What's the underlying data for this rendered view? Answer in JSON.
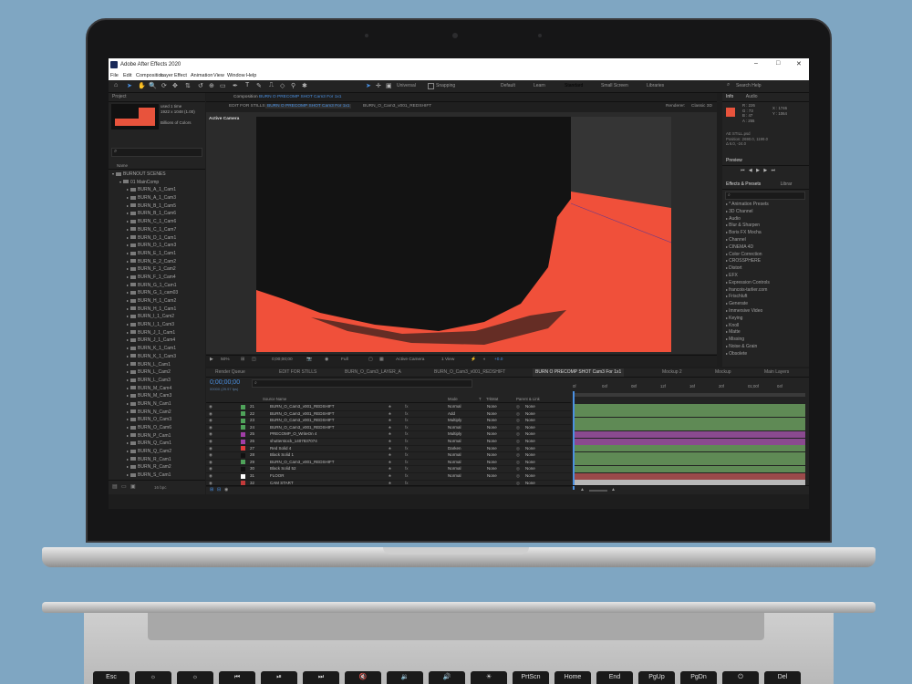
{
  "app": {
    "title": "Adobe After Effects 2020",
    "menu": [
      "File",
      "Edit",
      "Composition",
      "Layer",
      "Effect",
      "Animation",
      "View",
      "Window",
      "Help"
    ],
    "window_controls": [
      "–",
      "□",
      "✕"
    ]
  },
  "toolbar": {
    "universal_label": "Universal",
    "snapping_label": "Snapping",
    "workspaces": [
      "Default",
      "Learn",
      "Standard",
      "Small Screen",
      "Libraries"
    ],
    "search_help": "Search Help"
  },
  "project": {
    "tab": "Project",
    "thumb_info": [
      "1922 x 1048 (1.00)",
      "Billions of Colors"
    ],
    "used_text": "used 1 time",
    "name_header": "Name",
    "items": [
      {
        "label": "BURNOUT SCENES",
        "level": 0,
        "kind": "folder"
      },
      {
        "label": "01 MainComp",
        "level": 1,
        "kind": "folder"
      },
      {
        "label": "BURN_A_1_Cam1",
        "level": 2,
        "kind": "folder"
      },
      {
        "label": "BURN_A_1_Cam3",
        "level": 2,
        "kind": "folder"
      },
      {
        "label": "BURN_B_1_Cam5",
        "level": 2,
        "kind": "folder"
      },
      {
        "label": "BURN_B_1_Cam6",
        "level": 2,
        "kind": "folder"
      },
      {
        "label": "BURN_C_1_Cam6",
        "level": 2,
        "kind": "folder"
      },
      {
        "label": "BURN_C_1_Cam7",
        "level": 2,
        "kind": "folder"
      },
      {
        "label": "BURN_D_1_Cam1",
        "level": 2,
        "kind": "folder"
      },
      {
        "label": "BURN_D_1_Cam3",
        "level": 2,
        "kind": "folder"
      },
      {
        "label": "BURN_E_1_Cam1",
        "level": 2,
        "kind": "folder"
      },
      {
        "label": "BURN_E_2_Cam2",
        "level": 2,
        "kind": "folder"
      },
      {
        "label": "BURN_F_1_Cam2",
        "level": 2,
        "kind": "folder"
      },
      {
        "label": "BURN_F_1_Cam4",
        "level": 2,
        "kind": "folder"
      },
      {
        "label": "BURN_G_1_Cam1",
        "level": 2,
        "kind": "folder"
      },
      {
        "label": "BURN_G_1_cam03",
        "level": 2,
        "kind": "folder"
      },
      {
        "label": "BURN_H_1_Cam2",
        "level": 2,
        "kind": "folder"
      },
      {
        "label": "BURN_H_1_Cam1",
        "level": 2,
        "kind": "folder"
      },
      {
        "label": "BURN_I_1_Cam2",
        "level": 2,
        "kind": "folder"
      },
      {
        "label": "BURN_I_1_Cam3",
        "level": 2,
        "kind": "folder"
      },
      {
        "label": "BURN_J_1_Cam1",
        "level": 2,
        "kind": "folder"
      },
      {
        "label": "BURN_J_1_Cam4",
        "level": 2,
        "kind": "folder"
      },
      {
        "label": "BURN_K_1_Cam1",
        "level": 2,
        "kind": "folder"
      },
      {
        "label": "BURN_K_1_Cam3",
        "level": 2,
        "kind": "folder"
      },
      {
        "label": "BURN_L_Cam1",
        "level": 2,
        "kind": "folder"
      },
      {
        "label": "BURN_L_Cam2",
        "level": 2,
        "kind": "folder"
      },
      {
        "label": "BURN_L_Cam3",
        "level": 2,
        "kind": "folder"
      },
      {
        "label": "BURN_M_Cam4",
        "level": 2,
        "kind": "folder"
      },
      {
        "label": "BURN_M_Cam3",
        "level": 2,
        "kind": "folder"
      },
      {
        "label": "BURN_N_Cam1",
        "level": 2,
        "kind": "folder"
      },
      {
        "label": "BURN_N_Cam2",
        "level": 2,
        "kind": "folder"
      },
      {
        "label": "BURN_O_Cam3",
        "level": 2,
        "kind": "folder"
      },
      {
        "label": "BURN_O_Cam6",
        "level": 2,
        "kind": "folder"
      },
      {
        "label": "BURN_P_Cam1",
        "level": 2,
        "kind": "folder"
      },
      {
        "label": "BURN_Q_Cam1",
        "level": 2,
        "kind": "folder"
      },
      {
        "label": "BURN_Q_Cam2",
        "level": 2,
        "kind": "folder"
      },
      {
        "label": "BURN_R_Cam1",
        "level": 2,
        "kind": "folder"
      },
      {
        "label": "BURN_R_Cam2",
        "level": 2,
        "kind": "folder"
      },
      {
        "label": "BURN_S_Cam1",
        "level": 2,
        "kind": "folder"
      }
    ],
    "bpc": "16 bpc"
  },
  "composition": {
    "header_label": "Composition",
    "header_name": "BURN O PRECOMP SHOT Cam3 For 1x1",
    "subtabs": [
      "EDIT FOR STILLS",
      "BURN O PRECOMP SHOT Cam3 For 1x1",
      "BURN_O_Cam3_v001_REDSHIFT"
    ],
    "renderer": "Renderer:",
    "renderer_value": "Classic 3D",
    "viewer_label": "Active Camera",
    "footer": {
      "zoom": "50%",
      "timecode": "0;00;00;00",
      "resolution": "Full",
      "camera": "Active Camera",
      "views": "1 View",
      "offset": "+0.0"
    },
    "colors": {
      "bg": "#2b2b2b",
      "comp_bg": "#353535",
      "floor": "#f0503a",
      "shape": "#131313"
    }
  },
  "info": {
    "tabs": [
      "Info",
      "Audio"
    ],
    "color_values": [
      "R : 226",
      "G : 73",
      "B : 47",
      "A : 255"
    ],
    "xy": [
      "X : 1746",
      "Y : 1064"
    ],
    "file_lines": [
      "AE STILL.psd",
      "Position: 2690.0, 1199.0",
      "Δ 6.0, -24.0"
    ],
    "swatch": "#e8533c"
  },
  "preview": {
    "label": "Preview"
  },
  "effects": {
    "tabs": [
      "Effects & Presets",
      "Librar"
    ],
    "items": [
      "* Animation Presets",
      "3D Channel",
      "Audio",
      "Blur & Sharpen",
      "Boris FX Mocha",
      "Channel",
      "CINEMA 4D",
      "Color Correction",
      "CROSSPHERE",
      "Distort",
      "EFX",
      "Expression Controls",
      "francois-tarlier.com",
      "Frischluft",
      "Generate",
      "Immersive Video",
      "Keying",
      "Knoll",
      "Matte",
      "Missing",
      "Noise & Grain",
      "Obsolete"
    ]
  },
  "timeline": {
    "tabs": [
      "Render Queue",
      "EDIT FOR STILLS",
      "BURN_O_Cam3_LAYER_A",
      "BURN_O_Cam3_v001_REDSHIFT",
      "BURN O PRECOMP SHOT Cam3 For 1x1",
      "Mockup 2",
      "Mockup",
      "Main Layers"
    ],
    "timecode": "0;00;00;00",
    "fps": "00000 (29.97 fps)",
    "columns": {
      "source": "Source Name",
      "mode": "Mode",
      "trkmat": "TrkMat",
      "parent": "Parent & Link",
      "t": "T"
    },
    "ruler": [
      "0f",
      "04f",
      "08f",
      "12f",
      "16f",
      "20f",
      "01;00f",
      "04f"
    ],
    "layers": [
      {
        "num": "21",
        "name": "BURN_O_Cam3_v001_REDSHIFT",
        "mode": "Normal",
        "trk": "None",
        "parent": "None",
        "color": "#4fa35a",
        "bar": "#5f8a55"
      },
      {
        "num": "22",
        "name": "BURN_O_Cam3_v001_REDSHIFT",
        "mode": "Add",
        "trk": "None",
        "parent": "None",
        "color": "#4fa35a",
        "bar": "#5f8a55"
      },
      {
        "num": "23",
        "name": "BURN_O_Cam3_v001_REDSHIFT",
        "mode": "Multiply",
        "trk": "None",
        "parent": "None",
        "color": "#4fa35a",
        "bar": "#5f8a55"
      },
      {
        "num": "24",
        "name": "BURN_O_Cam3_v001_REDSHIFT",
        "mode": "Normal",
        "trk": "None",
        "parent": "None",
        "color": "#4fa35a",
        "bar": "#5f8a55"
      },
      {
        "num": "25",
        "name": "PRECOMP_O_WriteOn 4",
        "mode": "Multiply",
        "trk": "None",
        "parent": "None",
        "color": "#a13ea6",
        "bar": "#8a4a8f"
      },
      {
        "num": "26",
        "name": "shutterstock_1407837074",
        "mode": "Normal",
        "trk": "None",
        "parent": "None",
        "color": "#a13ea6",
        "bar": "#8a4a8f"
      },
      {
        "num": "27",
        "name": "Red Solid 4",
        "mode": "Darken",
        "trk": "None",
        "parent": "None",
        "color": "#e23a3a",
        "bar": "#5f8a55"
      },
      {
        "num": "28",
        "name": "Black Solid 1",
        "mode": "Normal",
        "trk": "None",
        "parent": "None",
        "color": "#111111",
        "bar": "#5f8a55"
      },
      {
        "num": "29",
        "name": "BURN_O_Cam3_v001_REDSHIFT",
        "mode": "Normal",
        "trk": "None",
        "parent": "None",
        "color": "#4fa35a",
        "bar": "#5f8a55"
      },
      {
        "num": "30",
        "name": "Black Solid 52",
        "mode": "Normal",
        "trk": "None",
        "parent": "None",
        "color": "#111111",
        "bar": "#5f8a55"
      },
      {
        "num": "31",
        "name": "FLOOR",
        "mode": "Normal",
        "trk": "None",
        "parent": "None",
        "color": "#ffffff",
        "bar": "#9a4a4a"
      },
      {
        "num": "32",
        "name": "CAM START",
        "mode": "",
        "trk": "",
        "parent": "None",
        "color": "#c23a3a",
        "bar": "#b8b8b8"
      }
    ]
  },
  "keyboard": [
    "Esc",
    "☼",
    "☼",
    "⏮",
    "⏯",
    "⏭",
    "🔇",
    "🔉",
    "🔊",
    "☀",
    "PrtScn",
    "Home",
    "End",
    "PgUp",
    "PgDn",
    "⏻",
    "Del"
  ]
}
